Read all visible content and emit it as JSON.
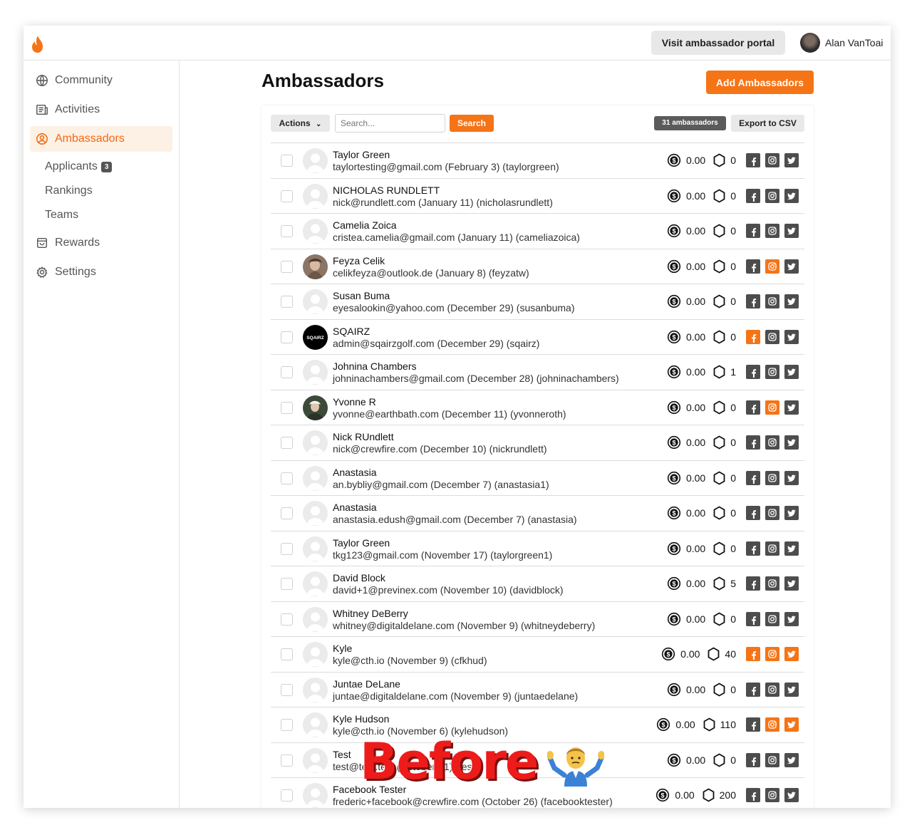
{
  "header": {
    "portal_button": "Visit ambassador portal",
    "user_name": "Alan VanToai",
    "brand_color": "#f57416"
  },
  "sidebar": {
    "items": [
      {
        "label": "Community",
        "icon": "globe-icon"
      },
      {
        "label": "Activities",
        "icon": "newspaper-icon"
      },
      {
        "label": "Ambassadors",
        "icon": "user-circle-icon",
        "active": true
      },
      {
        "label": "Rewards",
        "icon": "shopping-bag-icon"
      },
      {
        "label": "Settings",
        "icon": "gear-icon"
      }
    ],
    "subitems": [
      {
        "label": "Applicants",
        "badge": "3"
      },
      {
        "label": "Rankings"
      },
      {
        "label": "Teams"
      }
    ]
  },
  "main": {
    "title": "Ambassadors",
    "add_button": "Add Ambassadors",
    "toolbar": {
      "actions_label": "Actions",
      "search_placeholder": "Search...",
      "search_button": "Search",
      "count_label": "31 ambassadors",
      "export_label": "Export to CSV"
    },
    "ambassadors": [
      {
        "name": "Taylor Green",
        "sub": "taylortesting@gmail.com (February 3) (taylorgreen)",
        "money": "0.00",
        "points": "0",
        "facebook": false,
        "instagram": false,
        "twitter": false,
        "avatar": "placeholder"
      },
      {
        "name": "NICHOLAS RUNDLETT",
        "sub": "nick@rundlett.com (January 11) (nicholasrundlett)",
        "money": "0.00",
        "points": "0",
        "facebook": false,
        "instagram": false,
        "twitter": false,
        "avatar": "placeholder"
      },
      {
        "name": "Camelia Zoica",
        "sub": "cristea.camelia@gmail.com (January 11) (cameliazoica)",
        "money": "0.00",
        "points": "0",
        "facebook": false,
        "instagram": false,
        "twitter": false,
        "avatar": "placeholder"
      },
      {
        "name": "Feyza Celik",
        "sub": "celikfeyza@outlook.de (January 8) (feyzatw)",
        "money": "0.00",
        "points": "0",
        "facebook": false,
        "instagram": true,
        "twitter": false,
        "avatar": "photo"
      },
      {
        "name": "Susan Buma",
        "sub": "eyesalookin@yahoo.com (December 29) (susanbuma)",
        "money": "0.00",
        "points": "0",
        "facebook": false,
        "instagram": false,
        "twitter": false,
        "avatar": "placeholder"
      },
      {
        "name": "SQAIRZ",
        "sub": "admin@sqairzgolf.com (December 29) (sqairz)",
        "money": "0.00",
        "points": "0",
        "facebook": true,
        "instagram": false,
        "twitter": false,
        "avatar": "logo",
        "avatar_text": "SQAIRZ"
      },
      {
        "name": "Johnina Chambers",
        "sub": "johninachambers@gmail.com (December 28) (johninachambers)",
        "money": "0.00",
        "points": "1",
        "facebook": false,
        "instagram": false,
        "twitter": false,
        "avatar": "placeholder"
      },
      {
        "name": "Yvonne R",
        "sub": "yvonne@earthbath.com (December 11) (yvonneroth)",
        "money": "0.00",
        "points": "0",
        "facebook": false,
        "instagram": true,
        "twitter": false,
        "avatar": "photo2"
      },
      {
        "name": "Nick RUndlett",
        "sub": "nick@crewfire.com (December 10) (nickrundlett)",
        "money": "0.00",
        "points": "0",
        "facebook": false,
        "instagram": false,
        "twitter": false,
        "avatar": "placeholder"
      },
      {
        "name": "Anastasia",
        "sub": "an.bybliy@gmail.com (December 7) (anastasia1)",
        "money": "0.00",
        "points": "0",
        "facebook": false,
        "instagram": false,
        "twitter": false,
        "avatar": "placeholder"
      },
      {
        "name": "Anastasia",
        "sub": "anastasia.edush@gmail.com (December 7) (anastasia)",
        "money": "0.00",
        "points": "0",
        "facebook": false,
        "instagram": false,
        "twitter": false,
        "avatar": "placeholder"
      },
      {
        "name": "Taylor Green",
        "sub": "tkg123@gmail.com (November 17) (taylorgreen1)",
        "money": "0.00",
        "points": "0",
        "facebook": false,
        "instagram": false,
        "twitter": false,
        "avatar": "placeholder"
      },
      {
        "name": "David Block",
        "sub": "david+1@previnex.com (November 10) (davidblock)",
        "money": "0.00",
        "points": "5",
        "facebook": false,
        "instagram": false,
        "twitter": false,
        "avatar": "placeholder"
      },
      {
        "name": "Whitney DeBerry",
        "sub": "whitney@digitaldelane.com (November 9) (whitneydeberry)",
        "money": "0.00",
        "points": "0",
        "facebook": false,
        "instagram": false,
        "twitter": false,
        "avatar": "placeholder"
      },
      {
        "name": "Kyle",
        "sub": "kyle@cth.io (November 9) (cfkhud)",
        "money": "0.00",
        "points": "40",
        "facebook": true,
        "instagram": true,
        "twitter": true,
        "avatar": "placeholder"
      },
      {
        "name": "Juntae DeLane",
        "sub": "juntae@digitaldelane.com (November 9) (juntaedelane)",
        "money": "0.00",
        "points": "0",
        "facebook": false,
        "instagram": false,
        "twitter": false,
        "avatar": "placeholder"
      },
      {
        "name": "Kyle Hudson",
        "sub": "kyle@cth.io (November 6) (kylehudson)",
        "money": "0.00",
        "points": "110",
        "facebook": false,
        "instagram": true,
        "twitter": true,
        "avatar": "placeholder"
      },
      {
        "name": "Test",
        "sub": "test@test.test (October 31) (test)",
        "money": "0.00",
        "points": "0",
        "facebook": false,
        "instagram": false,
        "twitter": false,
        "avatar": "placeholder"
      },
      {
        "name": "Facebook Tester",
        "sub": "frederic+facebook@crewfire.com (October 26) (facebooktester)",
        "money": "0.00",
        "points": "200",
        "facebook": false,
        "instagram": false,
        "twitter": false,
        "avatar": "placeholder"
      }
    ]
  },
  "overlay": {
    "text": "Before",
    "emoji": "shrugging-man-icon"
  }
}
